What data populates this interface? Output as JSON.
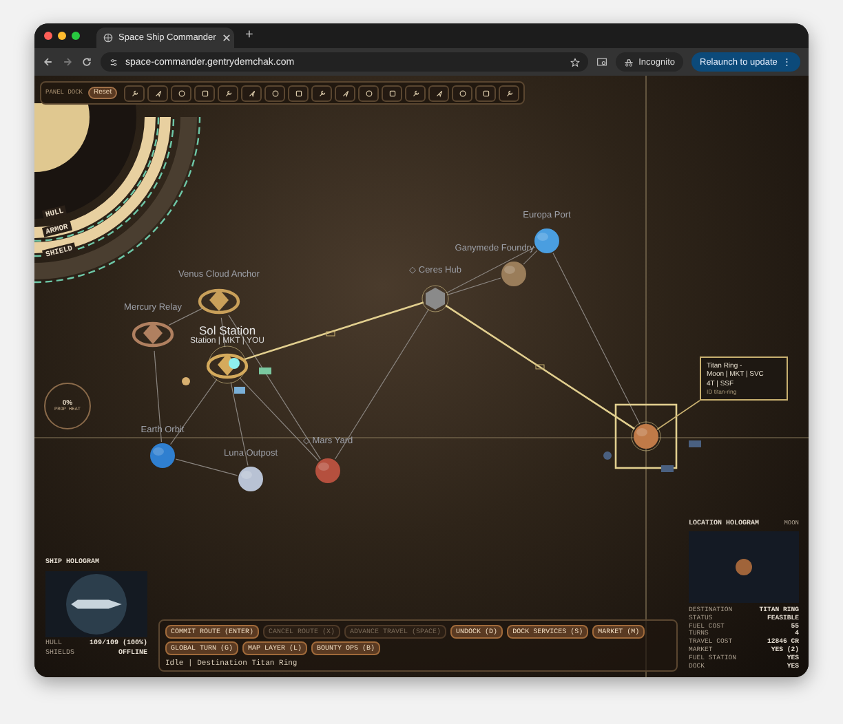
{
  "browser": {
    "tab_title": "Space Ship Commander",
    "new_tab": "+",
    "url": "space-commander.gentrydemchak.com",
    "incognito": "Incognito",
    "relaunch": "Relaunch to update",
    "relaunch_menu": "⋮"
  },
  "dock": {
    "label": "PANEL DOCK",
    "reset": "Reset"
  },
  "gauges": [
    {
      "label": "HULL"
    },
    {
      "label": "ARMOR"
    },
    {
      "label": "SHIELD"
    }
  ],
  "prop_heat": {
    "value": "0%",
    "label": "PROP HEAT"
  },
  "map": {
    "nodes": [
      {
        "name": "Europa Port",
        "kind": "planet",
        "color": "#4a9ee0",
        "selected": false,
        "current": false,
        "on_route": false
      },
      {
        "name": "Ganymede Foundry",
        "kind": "planet",
        "color": "#9a7d5a",
        "selected": false,
        "current": false,
        "on_route": false
      },
      {
        "name": "◇ Ceres Hub",
        "kind": "hub",
        "color": "#8a8a8a",
        "selected": false,
        "current": false,
        "on_route": true
      },
      {
        "name": "Venus Cloud Anchor",
        "kind": "station",
        "color": "#c9a05a",
        "selected": false,
        "current": false,
        "on_route": false
      },
      {
        "name": "Mercury Relay",
        "kind": "station",
        "color": "#b08060",
        "selected": false,
        "current": false,
        "on_route": false
      },
      {
        "name": "Sol Station",
        "subtitle": "Station | MKT | YOU",
        "kind": "station",
        "color": "#d4aa5c",
        "selected": false,
        "current": true,
        "on_route": true
      },
      {
        "name": "Earth Orbit",
        "kind": "planet",
        "color": "#2f7fd0",
        "selected": false,
        "current": false,
        "on_route": false
      },
      {
        "name": "◇ Mars Yard",
        "kind": "planet",
        "color": "#b5503e",
        "selected": false,
        "current": false,
        "on_route": false
      },
      {
        "name": "Luna Outpost",
        "kind": "planet",
        "color": "#b8c2d4",
        "selected": false,
        "current": false,
        "on_route": false
      },
      {
        "kind": "planet",
        "color": "#c07a48",
        "selected": true,
        "current": false,
        "on_route": true
      }
    ],
    "tooltip": [
      "Titan Ring -",
      "Moon | MKT | SVC",
      "4T | SSF",
      "ID titan-ring"
    ]
  },
  "ship_hologram": {
    "title": "SHIP HOLOGRAM",
    "stats": [
      {
        "label": "HULL",
        "value": "109/109 (100%)"
      },
      {
        "label": "SHIELDS",
        "value": "OFFLINE"
      }
    ]
  },
  "actions": [
    {
      "label": "COMMIT ROUTE (ENTER)",
      "disabled": false
    },
    {
      "label": "CANCEL ROUTE (X)",
      "disabled": true
    },
    {
      "label": "ADVANCE TRAVEL (SPACE)",
      "disabled": true
    },
    {
      "label": "UNDOCK (D)",
      "disabled": false
    },
    {
      "label": "DOCK SERVICES (S)",
      "disabled": false
    },
    {
      "label": "MARKET (M)",
      "disabled": false
    },
    {
      "label": "GLOBAL TURN (G)",
      "disabled": false
    },
    {
      "label": "MAP LAYER (L)",
      "disabled": false
    },
    {
      "label": "BOUNTY OPS (B)",
      "disabled": false
    }
  ],
  "status": "Idle | Destination Titan Ring",
  "location_hologram": {
    "title": "LOCATION HOLOGRAM",
    "type": "MOON",
    "stats": [
      {
        "label": "DESTINATION",
        "value": "TITAN RING"
      },
      {
        "label": "STATUS",
        "value": "FEASIBLE"
      },
      {
        "label": "FUEL COST",
        "value": "55"
      },
      {
        "label": "TURNS",
        "value": "4"
      },
      {
        "label": "TRAVEL COST",
        "value": "12846 CR"
      },
      {
        "label": "MARKET",
        "value": "YES (2)"
      },
      {
        "label": "FUEL STATION",
        "value": "YES"
      },
      {
        "label": "DOCK",
        "value": "YES"
      }
    ]
  }
}
